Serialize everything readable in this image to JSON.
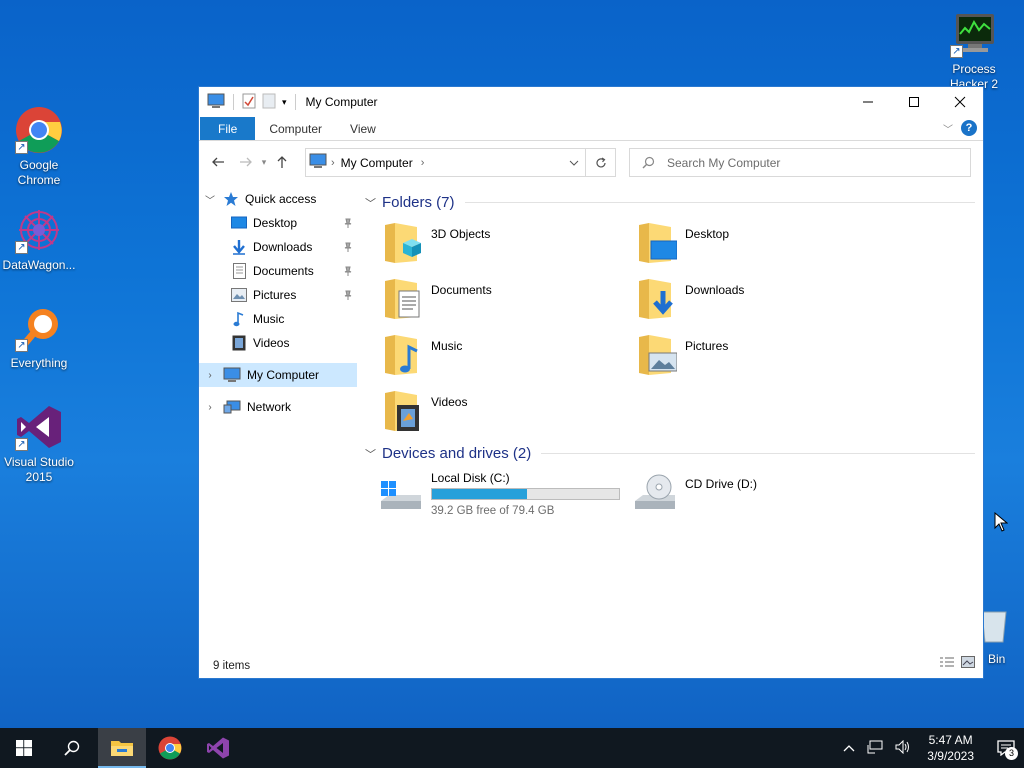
{
  "desktop": {
    "icons": [
      {
        "label": "Google Chrome"
      },
      {
        "label": "DataWagon..."
      },
      {
        "label": "Everything"
      },
      {
        "label": "Visual Studio 2015"
      },
      {
        "label": "Process Hacker 2"
      },
      {
        "label": "Bin"
      }
    ]
  },
  "window": {
    "title": "My Computer",
    "ribbon": {
      "tabs": [
        "File",
        "Computer",
        "View"
      ]
    },
    "address": {
      "path": "My Computer"
    },
    "search": {
      "placeholder": "Search My Computer"
    },
    "navpane": {
      "quick_access": "Quick access",
      "items": [
        "Desktop",
        "Downloads",
        "Documents",
        "Pictures",
        "Music",
        "Videos"
      ],
      "my_computer": "My Computer",
      "network": "Network"
    },
    "folders": {
      "heading": "Folders (7)",
      "items": [
        "3D Objects",
        "Desktop",
        "Documents",
        "Downloads",
        "Music",
        "Pictures",
        "Videos"
      ]
    },
    "drives": {
      "heading": "Devices and drives (2)",
      "local": {
        "name": "Local Disk (C:)",
        "free": "39.2 GB free of 79.4 GB",
        "used_fraction": 0.506
      },
      "cd": {
        "name": "CD Drive (D:)"
      }
    },
    "status": "9 items"
  },
  "taskbar": {
    "time": "5:47 AM",
    "date": "3/9/2023",
    "notifications": "3"
  },
  "colors": {
    "accent": "#1979ca",
    "selection": "#cce8ff",
    "group_heading": "#1e3287",
    "drive_bar": "#26a0da",
    "taskbar": "#101820"
  }
}
